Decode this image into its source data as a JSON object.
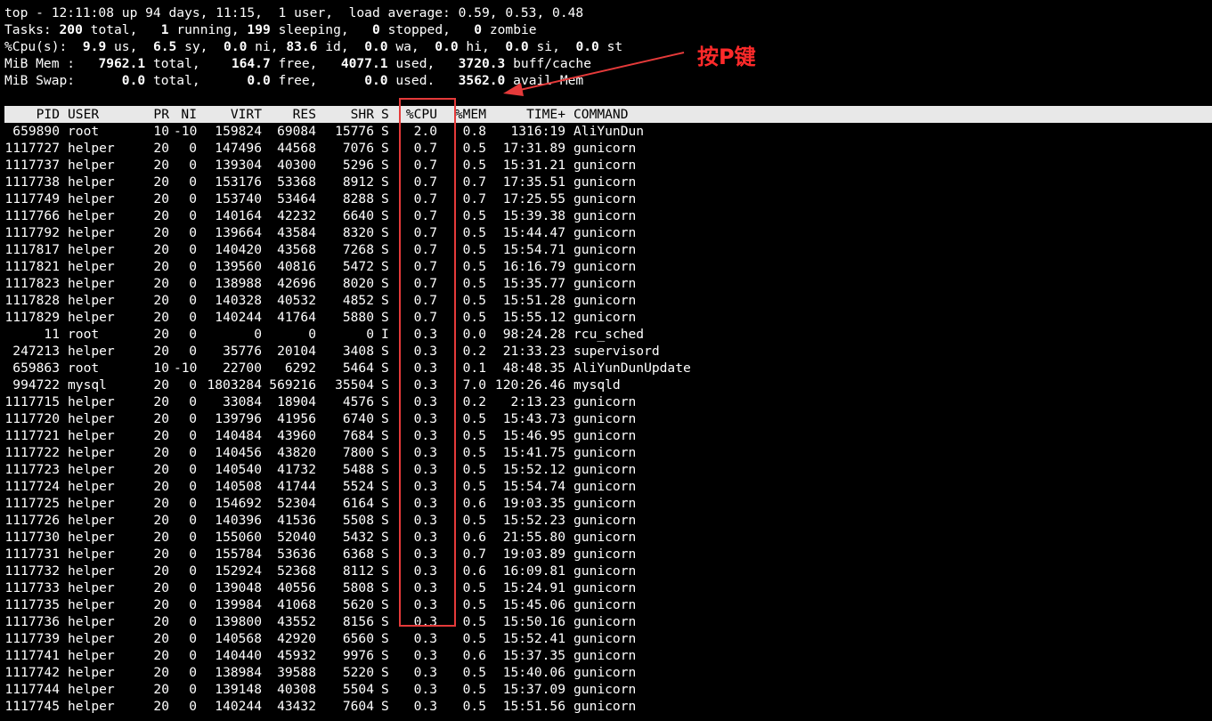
{
  "summary": {
    "top": [
      "top - 12:11:08 up 94 days, 11:15,  1 user,  load average: 0.59, 0.53, 0.48"
    ],
    "tasks": [
      "Tasks: ",
      "200",
      " total,   ",
      "1",
      " running, ",
      "199",
      " sleeping,   ",
      "0",
      " stopped,   ",
      "0",
      " zombie"
    ],
    "cpu": [
      "%Cpu(s):  ",
      "9.9",
      " us,  ",
      "6.5",
      " sy,  ",
      "0.0",
      " ni, ",
      "83.6",
      " id,  ",
      "0.0",
      " wa,  ",
      "0.0",
      " hi,  ",
      "0.0",
      " si,  ",
      "0.0",
      " st"
    ],
    "mem": [
      "MiB Mem :   ",
      "7962.1",
      " total,    ",
      "164.7",
      " free,   ",
      "4077.1",
      " used,   ",
      "3720.3",
      " buff/cache"
    ],
    "swap": [
      "MiB Swap:      ",
      "0.0",
      " total,      ",
      "0.0",
      " free,      ",
      "0.0",
      " used.   ",
      "3562.0",
      " avail Mem"
    ]
  },
  "header": {
    "pid": "PID",
    "user": "USER",
    "pr": "PR",
    "ni": "NI",
    "virt": "VIRT",
    "res": "RES",
    "shr": "SHR",
    "s": "S",
    "cpu": "%CPU",
    "mem": "%MEM",
    "time": "TIME+",
    "command": "COMMAND"
  },
  "processes": [
    {
      "pid": "659890",
      "user": "root",
      "pr": "10",
      "ni": "-10",
      "virt": "159824",
      "res": "69084",
      "shr": "15776",
      "s": "S",
      "cpu": "2.0",
      "mem": "0.8",
      "time": "1316:19",
      "command": "AliYunDun"
    },
    {
      "pid": "1117727",
      "user": "helper",
      "pr": "20",
      "ni": "0",
      "virt": "147496",
      "res": "44568",
      "shr": "7076",
      "s": "S",
      "cpu": "0.7",
      "mem": "0.5",
      "time": "17:31.89",
      "command": "gunicorn"
    },
    {
      "pid": "1117737",
      "user": "helper",
      "pr": "20",
      "ni": "0",
      "virt": "139304",
      "res": "40300",
      "shr": "5296",
      "s": "S",
      "cpu": "0.7",
      "mem": "0.5",
      "time": "15:31.21",
      "command": "gunicorn"
    },
    {
      "pid": "1117738",
      "user": "helper",
      "pr": "20",
      "ni": "0",
      "virt": "153176",
      "res": "53368",
      "shr": "8912",
      "s": "S",
      "cpu": "0.7",
      "mem": "0.7",
      "time": "17:35.51",
      "command": "gunicorn"
    },
    {
      "pid": "1117749",
      "user": "helper",
      "pr": "20",
      "ni": "0",
      "virt": "153740",
      "res": "53464",
      "shr": "8288",
      "s": "S",
      "cpu": "0.7",
      "mem": "0.7",
      "time": "17:25.55",
      "command": "gunicorn"
    },
    {
      "pid": "1117766",
      "user": "helper",
      "pr": "20",
      "ni": "0",
      "virt": "140164",
      "res": "42232",
      "shr": "6640",
      "s": "S",
      "cpu": "0.7",
      "mem": "0.5",
      "time": "15:39.38",
      "command": "gunicorn"
    },
    {
      "pid": "1117792",
      "user": "helper",
      "pr": "20",
      "ni": "0",
      "virt": "139664",
      "res": "43584",
      "shr": "8320",
      "s": "S",
      "cpu": "0.7",
      "mem": "0.5",
      "time": "15:44.47",
      "command": "gunicorn"
    },
    {
      "pid": "1117817",
      "user": "helper",
      "pr": "20",
      "ni": "0",
      "virt": "140420",
      "res": "43568",
      "shr": "7268",
      "s": "S",
      "cpu": "0.7",
      "mem": "0.5",
      "time": "15:54.71",
      "command": "gunicorn"
    },
    {
      "pid": "1117821",
      "user": "helper",
      "pr": "20",
      "ni": "0",
      "virt": "139560",
      "res": "40816",
      "shr": "5472",
      "s": "S",
      "cpu": "0.7",
      "mem": "0.5",
      "time": "16:16.79",
      "command": "gunicorn"
    },
    {
      "pid": "1117823",
      "user": "helper",
      "pr": "20",
      "ni": "0",
      "virt": "138988",
      "res": "42696",
      "shr": "8020",
      "s": "S",
      "cpu": "0.7",
      "mem": "0.5",
      "time": "15:35.77",
      "command": "gunicorn"
    },
    {
      "pid": "1117828",
      "user": "helper",
      "pr": "20",
      "ni": "0",
      "virt": "140328",
      "res": "40532",
      "shr": "4852",
      "s": "S",
      "cpu": "0.7",
      "mem": "0.5",
      "time": "15:51.28",
      "command": "gunicorn"
    },
    {
      "pid": "1117829",
      "user": "helper",
      "pr": "20",
      "ni": "0",
      "virt": "140244",
      "res": "41764",
      "shr": "5880",
      "s": "S",
      "cpu": "0.7",
      "mem": "0.5",
      "time": "15:55.12",
      "command": "gunicorn"
    },
    {
      "pid": "11",
      "user": "root",
      "pr": "20",
      "ni": "0",
      "virt": "0",
      "res": "0",
      "shr": "0",
      "s": "I",
      "cpu": "0.3",
      "mem": "0.0",
      "time": "98:24.28",
      "command": "rcu_sched"
    },
    {
      "pid": "247213",
      "user": "helper",
      "pr": "20",
      "ni": "0",
      "virt": "35776",
      "res": "20104",
      "shr": "3408",
      "s": "S",
      "cpu": "0.3",
      "mem": "0.2",
      "time": "21:33.23",
      "command": "supervisord"
    },
    {
      "pid": "659863",
      "user": "root",
      "pr": "10",
      "ni": "-10",
      "virt": "22700",
      "res": "6292",
      "shr": "5464",
      "s": "S",
      "cpu": "0.3",
      "mem": "0.1",
      "time": "48:48.35",
      "command": "AliYunDunUpdate"
    },
    {
      "pid": "994722",
      "user": "mysql",
      "pr": "20",
      "ni": "0",
      "virt": "1803284",
      "res": "569216",
      "shr": "35504",
      "s": "S",
      "cpu": "0.3",
      "mem": "7.0",
      "time": "120:26.46",
      "command": "mysqld"
    },
    {
      "pid": "1117715",
      "user": "helper",
      "pr": "20",
      "ni": "0",
      "virt": "33084",
      "res": "18904",
      "shr": "4576",
      "s": "S",
      "cpu": "0.3",
      "mem": "0.2",
      "time": "2:13.23",
      "command": "gunicorn"
    },
    {
      "pid": "1117720",
      "user": "helper",
      "pr": "20",
      "ni": "0",
      "virt": "139796",
      "res": "41956",
      "shr": "6740",
      "s": "S",
      "cpu": "0.3",
      "mem": "0.5",
      "time": "15:43.73",
      "command": "gunicorn"
    },
    {
      "pid": "1117721",
      "user": "helper",
      "pr": "20",
      "ni": "0",
      "virt": "140484",
      "res": "43960",
      "shr": "7684",
      "s": "S",
      "cpu": "0.3",
      "mem": "0.5",
      "time": "15:46.95",
      "command": "gunicorn"
    },
    {
      "pid": "1117722",
      "user": "helper",
      "pr": "20",
      "ni": "0",
      "virt": "140456",
      "res": "43820",
      "shr": "7800",
      "s": "S",
      "cpu": "0.3",
      "mem": "0.5",
      "time": "15:41.75",
      "command": "gunicorn"
    },
    {
      "pid": "1117723",
      "user": "helper",
      "pr": "20",
      "ni": "0",
      "virt": "140540",
      "res": "41732",
      "shr": "5488",
      "s": "S",
      "cpu": "0.3",
      "mem": "0.5",
      "time": "15:52.12",
      "command": "gunicorn"
    },
    {
      "pid": "1117724",
      "user": "helper",
      "pr": "20",
      "ni": "0",
      "virt": "140508",
      "res": "41744",
      "shr": "5524",
      "s": "S",
      "cpu": "0.3",
      "mem": "0.5",
      "time": "15:54.74",
      "command": "gunicorn"
    },
    {
      "pid": "1117725",
      "user": "helper",
      "pr": "20",
      "ni": "0",
      "virt": "154692",
      "res": "52304",
      "shr": "6164",
      "s": "S",
      "cpu": "0.3",
      "mem": "0.6",
      "time": "19:03.35",
      "command": "gunicorn"
    },
    {
      "pid": "1117726",
      "user": "helper",
      "pr": "20",
      "ni": "0",
      "virt": "140396",
      "res": "41536",
      "shr": "5508",
      "s": "S",
      "cpu": "0.3",
      "mem": "0.5",
      "time": "15:52.23",
      "command": "gunicorn"
    },
    {
      "pid": "1117730",
      "user": "helper",
      "pr": "20",
      "ni": "0",
      "virt": "155060",
      "res": "52040",
      "shr": "5432",
      "s": "S",
      "cpu": "0.3",
      "mem": "0.6",
      "time": "21:55.80",
      "command": "gunicorn"
    },
    {
      "pid": "1117731",
      "user": "helper",
      "pr": "20",
      "ni": "0",
      "virt": "155784",
      "res": "53636",
      "shr": "6368",
      "s": "S",
      "cpu": "0.3",
      "mem": "0.7",
      "time": "19:03.89",
      "command": "gunicorn"
    },
    {
      "pid": "1117732",
      "user": "helper",
      "pr": "20",
      "ni": "0",
      "virt": "152924",
      "res": "52368",
      "shr": "8112",
      "s": "S",
      "cpu": "0.3",
      "mem": "0.6",
      "time": "16:09.81",
      "command": "gunicorn"
    },
    {
      "pid": "1117733",
      "user": "helper",
      "pr": "20",
      "ni": "0",
      "virt": "139048",
      "res": "40556",
      "shr": "5808",
      "s": "S",
      "cpu": "0.3",
      "mem": "0.5",
      "time": "15:24.91",
      "command": "gunicorn"
    },
    {
      "pid": "1117735",
      "user": "helper",
      "pr": "20",
      "ni": "0",
      "virt": "139984",
      "res": "41068",
      "shr": "5620",
      "s": "S",
      "cpu": "0.3",
      "mem": "0.5",
      "time": "15:45.06",
      "command": "gunicorn"
    },
    {
      "pid": "1117736",
      "user": "helper",
      "pr": "20",
      "ni": "0",
      "virt": "139800",
      "res": "43552",
      "shr": "8156",
      "s": "S",
      "cpu": "0.3",
      "mem": "0.5",
      "time": "15:50.16",
      "command": "gunicorn"
    },
    {
      "pid": "1117739",
      "user": "helper",
      "pr": "20",
      "ni": "0",
      "virt": "140568",
      "res": "42920",
      "shr": "6560",
      "s": "S",
      "cpu": "0.3",
      "mem": "0.5",
      "time": "15:52.41",
      "command": "gunicorn"
    },
    {
      "pid": "1117741",
      "user": "helper",
      "pr": "20",
      "ni": "0",
      "virt": "140440",
      "res": "45932",
      "shr": "9976",
      "s": "S",
      "cpu": "0.3",
      "mem": "0.6",
      "time": "15:37.35",
      "command": "gunicorn"
    },
    {
      "pid": "1117742",
      "user": "helper",
      "pr": "20",
      "ni": "0",
      "virt": "138984",
      "res": "39588",
      "shr": "5220",
      "s": "S",
      "cpu": "0.3",
      "mem": "0.5",
      "time": "15:40.06",
      "command": "gunicorn"
    },
    {
      "pid": "1117744",
      "user": "helper",
      "pr": "20",
      "ni": "0",
      "virt": "139148",
      "res": "40308",
      "shr": "5504",
      "s": "S",
      "cpu": "0.3",
      "mem": "0.5",
      "time": "15:37.09",
      "command": "gunicorn"
    },
    {
      "pid": "1117745",
      "user": "helper",
      "pr": "20",
      "ni": "0",
      "virt": "140244",
      "res": "43432",
      "shr": "7604",
      "s": "S",
      "cpu": "0.3",
      "mem": "0.5",
      "time": "15:51.56",
      "command": "gunicorn"
    }
  ],
  "annotation": {
    "label": "按P键",
    "color": "#e53a3a"
  }
}
